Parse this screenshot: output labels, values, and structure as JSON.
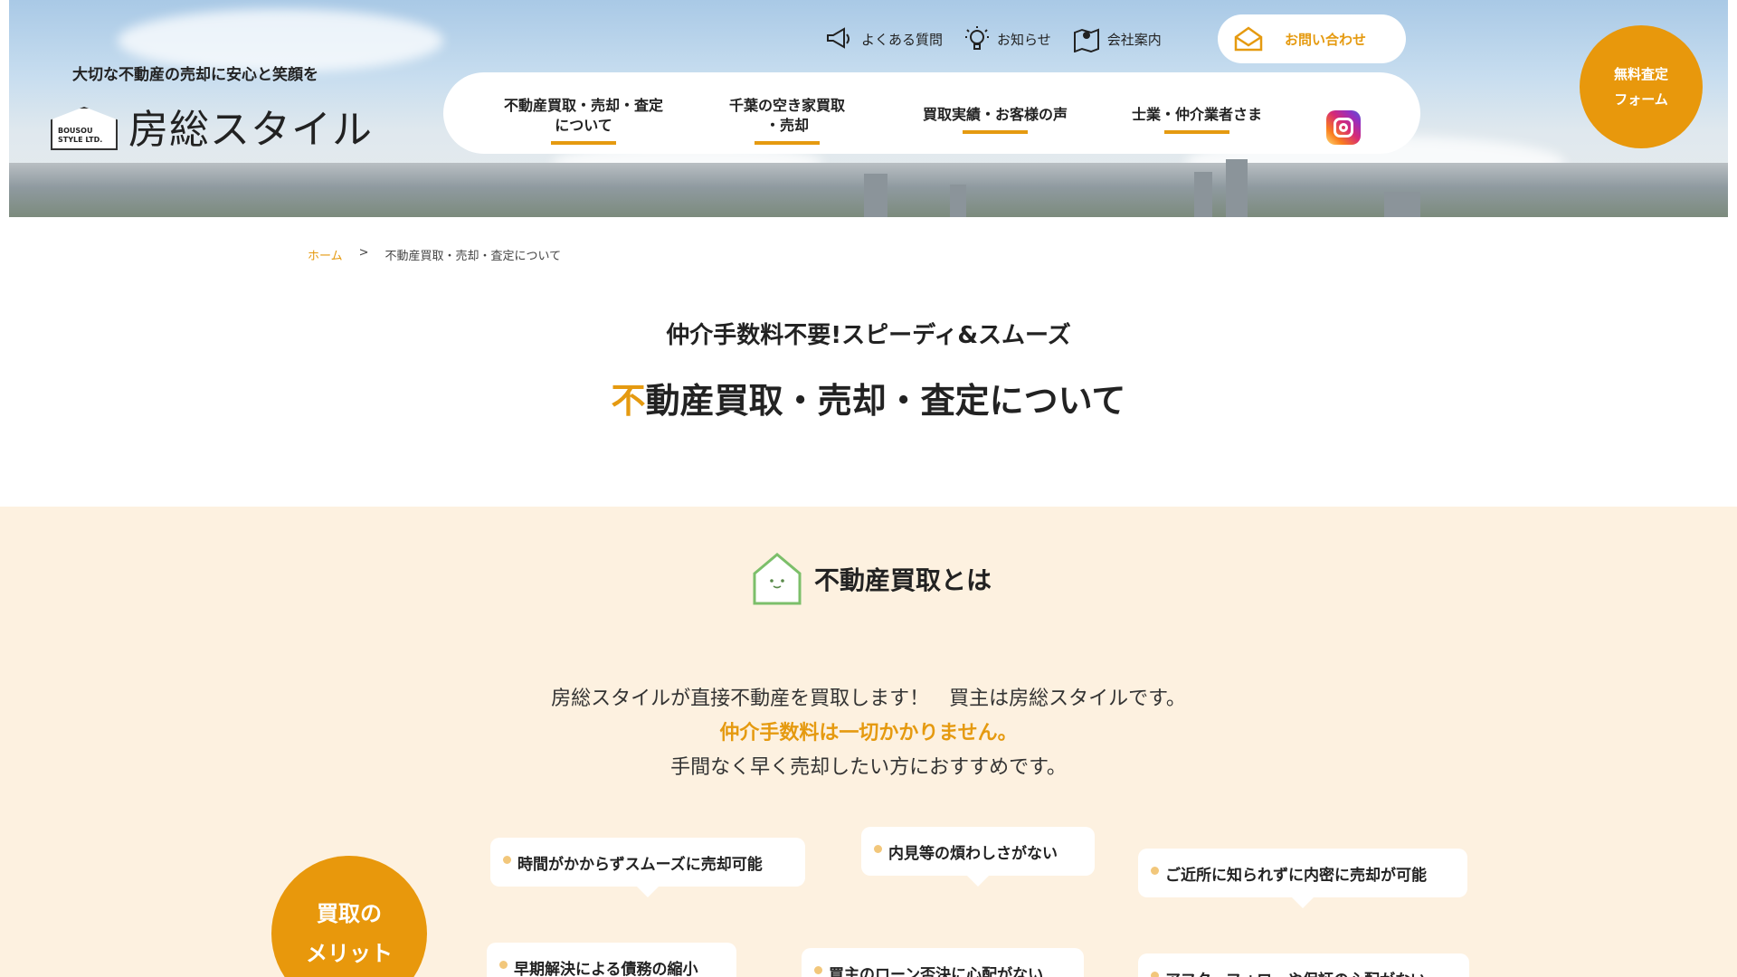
{
  "header": {
    "tagline": "大切な不動産の売却に安心と笑顔を",
    "logo_mark_text": "BOUSOU STYLE LTD.",
    "logo_name": "房総スタイル",
    "util_nav": [
      {
        "label": "よくある質問",
        "icon": "megaphone-icon"
      },
      {
        "label": "お知らせ",
        "icon": "lightbulb-icon"
      },
      {
        "label": "会社案内",
        "icon": "map-pin-icon"
      }
    ],
    "contact_label": "お問い合わせ",
    "contact_icon": "mail-icon",
    "main_nav": [
      {
        "line1": "不動産買取・売却・査定",
        "line2": "について"
      },
      {
        "line1": "千葉の空き家買取",
        "line2": "・売却"
      },
      {
        "line1": "買取実績・お客様の声",
        "line2": ""
      },
      {
        "line1": "士業・仲介業者さま",
        "line2": ""
      }
    ],
    "instagram_icon": "instagram-icon",
    "free_form_label": "無料査定\nフォーム"
  },
  "breadcrumb": {
    "home": "ホーム",
    "separator": ">",
    "current": "不動産買取・売却・査定について"
  },
  "hero_titles": {
    "subtitle": "仲介手数料不要!スピーディ&スムーズ",
    "title_first_char": "不",
    "title_rest": "動産買取・売却・査定について"
  },
  "section": {
    "icon": "house-icon",
    "heading": "不動産買取とは",
    "intro_line1": "房総スタイルが直接不動産を買取します！　買主は房総スタイルです。",
    "intro_line2": "仲介手数料は一切かかりません。",
    "intro_line3": "手間なく早く売却したい方におすすめです。",
    "merit_label": "買取の\nメリット",
    "merits": [
      "時間がかからずスムーズに売却可能",
      "内見等の煩わしさがない",
      "ご近所に知られずに内密に売却が可能",
      "早期解決による債務の縮小",
      "買主のローン否決に心配がない",
      "アフターフォローや保証の心配がない"
    ]
  },
  "colors": {
    "accent": "#e59a10",
    "cream_bg": "#fdf1e0",
    "text": "#222222"
  }
}
